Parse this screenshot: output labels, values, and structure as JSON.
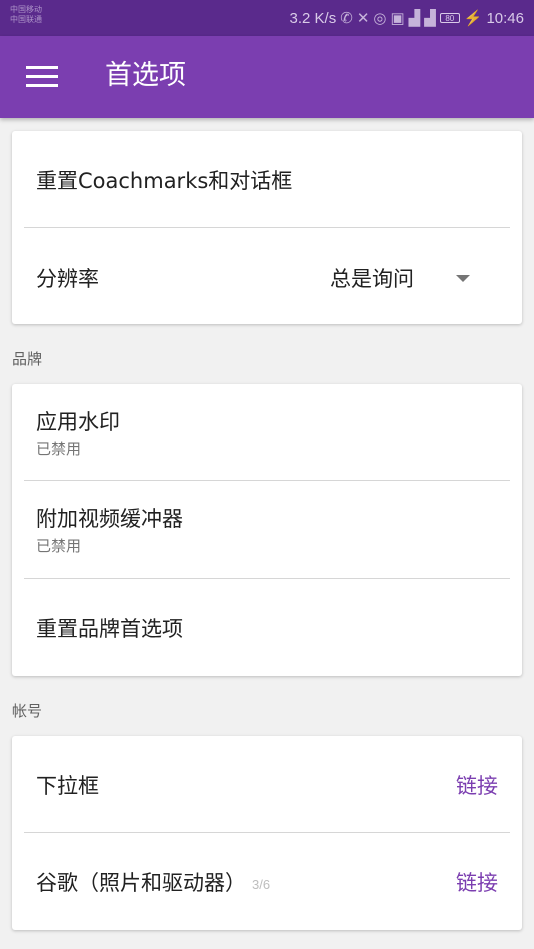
{
  "status_bar": {
    "carrier_1": "中国移动",
    "carrier_2": "中国联通",
    "speed": "3.2 K/s",
    "battery": "80",
    "time": "10:46"
  },
  "header": {
    "title": "首选项",
    "menu_icon": "hamburger-menu-icon"
  },
  "general": {
    "reset_coachmarks": "重置Coachmarks和对话框",
    "resolution_label": "分辨率",
    "resolution_value": "总是询问"
  },
  "brand": {
    "section_label": "品牌",
    "watermark_title": "应用水印",
    "watermark_status": "已禁用",
    "video_buffer_title": "附加视频缓冲器",
    "video_buffer_status": "已禁用",
    "reset_brand": "重置品牌首选项"
  },
  "account": {
    "section_label": "帐号",
    "items": [
      {
        "label": "下拉框",
        "action": "链接"
      },
      {
        "label": "谷歌（照片和驱动器）",
        "action": "链接"
      }
    ]
  },
  "page_indicator": "3/6",
  "colors": {
    "status_bar": "#5a2a8c",
    "app_bar": "#7b3eb0",
    "accent": "#7b3eb0",
    "background": "#f1f1f1"
  }
}
